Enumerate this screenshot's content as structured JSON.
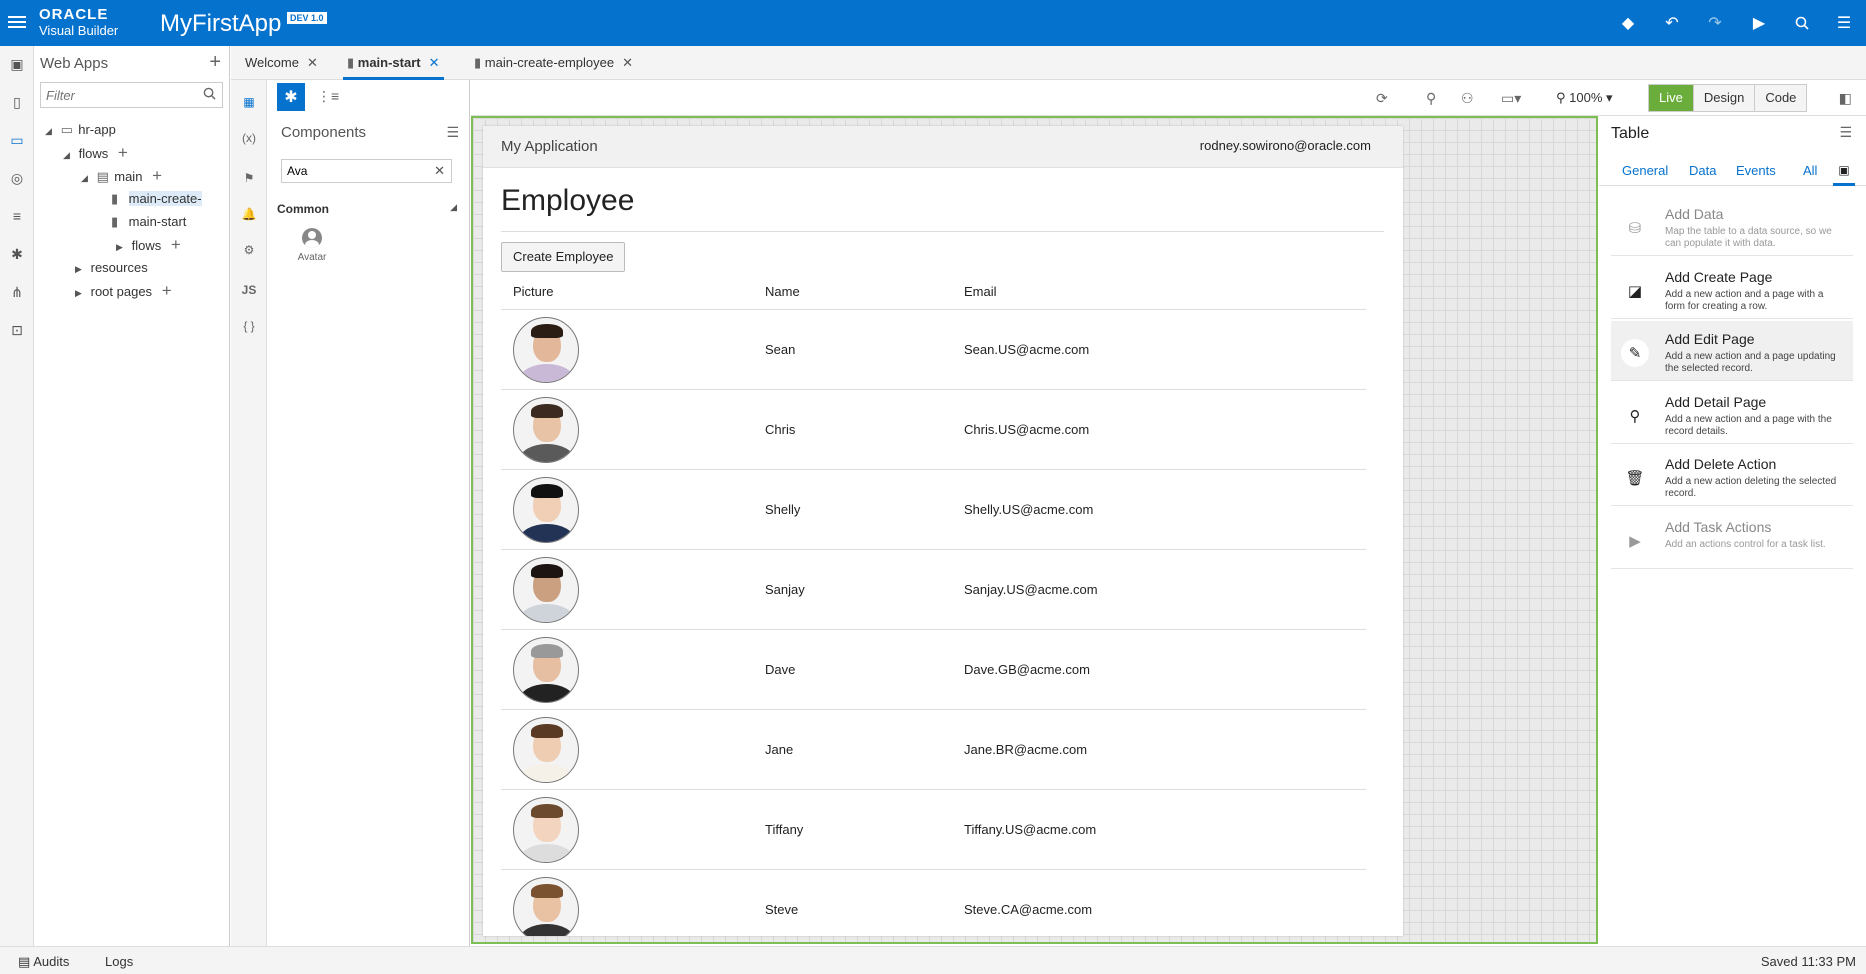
{
  "header": {
    "brand_line1": "ORACLE",
    "brand_line2": "Visual Builder",
    "app_name": "MyFirstApp",
    "badge": "DEV 1.0",
    "icons": [
      "git-icon",
      "undo-icon",
      "redo-icon",
      "run-icon",
      "search-icon",
      "menu-icon"
    ],
    "color": "#0572ce"
  },
  "navigator": {
    "title": "Web Apps",
    "filter_placeholder": "Filter",
    "tree": [
      {
        "label": "hr-app",
        "level": 0,
        "expanded": true,
        "icon": "desktop-icon"
      },
      {
        "label": "flows",
        "level": 1,
        "expanded": true,
        "add": true
      },
      {
        "label": "main",
        "level": 2,
        "expanded": true,
        "icon": "flow-icon",
        "add": true
      },
      {
        "label": "main-create-",
        "level": 3,
        "icon": "page-icon",
        "selected": true
      },
      {
        "label": "main-start",
        "level": 3,
        "icon": "page-icon"
      },
      {
        "label": "flows",
        "level": 3,
        "collapsed": true,
        "add": true
      },
      {
        "label": "resources",
        "level": 1,
        "collapsed": true
      },
      {
        "label": "root pages",
        "level": 1,
        "collapsed": true,
        "add": true
      }
    ]
  },
  "tabs": [
    {
      "label": "Welcome",
      "active": false
    },
    {
      "label": "main-start",
      "active": true
    },
    {
      "label": "main-create-employee",
      "active": false
    }
  ],
  "components": {
    "title": "Components",
    "search_value": "Ava",
    "category": "Common",
    "items": [
      {
        "label": "Avatar",
        "icon": "avatar-icon"
      }
    ]
  },
  "toolbar": {
    "zoom": "100%",
    "modes": [
      "Live",
      "Design",
      "Code"
    ],
    "active_mode": "Live"
  },
  "page": {
    "app_title": "My Application",
    "user": "rodney.sowirono@oracle.com",
    "heading": "Employee",
    "create_button": "Create Employee",
    "columns": [
      "Picture",
      "Name",
      "Email"
    ],
    "rows": [
      {
        "name": "Sean",
        "email": "Sean.US@acme.com"
      },
      {
        "name": "Chris",
        "email": "Chris.US@acme.com"
      },
      {
        "name": "Shelly",
        "email": "Shelly.US@acme.com"
      },
      {
        "name": "Sanjay",
        "email": "Sanjay.US@acme.com"
      },
      {
        "name": "Dave",
        "email": "Dave.GB@acme.com"
      },
      {
        "name": "Jane",
        "email": "Jane.BR@acme.com"
      },
      {
        "name": "Tiffany",
        "email": "Tiffany.US@acme.com"
      },
      {
        "name": "Steve",
        "email": "Steve.CA@acme.com"
      }
    ]
  },
  "properties": {
    "title": "Table",
    "tabs": [
      "General",
      "Data",
      "Events",
      "All"
    ],
    "actions": [
      {
        "title": "Add Data",
        "desc": "Map the table to a data source, so we can populate it with data.",
        "enabled": false,
        "icon": "data-icon"
      },
      {
        "title": "Add Create Page",
        "desc": "Add a new action and a page with a form for creating a row.",
        "enabled": true,
        "icon": "create-page-icon"
      },
      {
        "title": "Add Edit Page",
        "desc": "Add a new action and a page updating the selected record.",
        "enabled": true,
        "icon": "edit-page-icon",
        "highlighted": true
      },
      {
        "title": "Add Detail Page",
        "desc": "Add a new action and a page with the record details.",
        "enabled": true,
        "icon": "detail-page-icon"
      },
      {
        "title": "Add Delete Action",
        "desc": "Add a new action deleting the selected record.",
        "enabled": true,
        "icon": "trash-icon"
      },
      {
        "title": "Add Task Actions",
        "desc": "Add an actions control for a task list.",
        "enabled": false,
        "icon": "play-icon"
      }
    ]
  },
  "status": {
    "audits": "Audits",
    "logs": "Logs",
    "saved": "Saved 11:33 PM"
  }
}
